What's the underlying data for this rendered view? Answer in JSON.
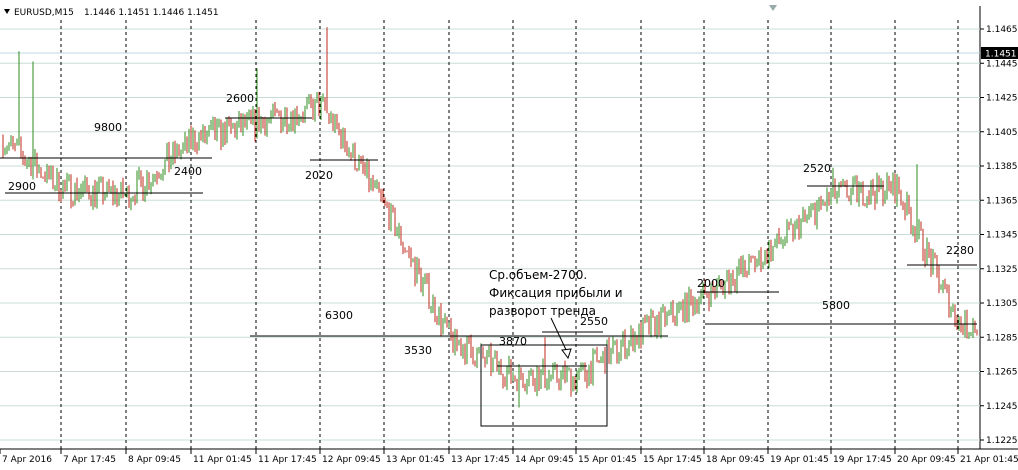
{
  "header": {
    "symbol": "EURUSD,M15",
    "ohlc": "1.1446 1.1451 1.1446 1.1451"
  },
  "price_axis": {
    "current_price": "1.1451",
    "levels": [
      "1.1465",
      "1.1445",
      "1.1425",
      "1.1405",
      "1.1385",
      "1.1365",
      "1.1345",
      "1.1325",
      "1.1305",
      "1.1285",
      "1.1265",
      "1.1245",
      "1.1225"
    ]
  },
  "time_axis": {
    "labels": [
      "7 Apr 2016",
      "7 Apr 17:45",
      "8 Apr 09:45",
      "11 Apr 01:45",
      "11 Apr 17:45",
      "12 Apr 09:45",
      "13 Apr 01:45",
      "13 Apr 17:45",
      "14 Apr 09:45",
      "15 Apr 01:45",
      "15 Apr 17:45",
      "18 Apr 09:45",
      "19 Apr 01:45",
      "19 Apr 17:45",
      "20 Apr 09:45",
      "21 Apr 01:45"
    ]
  },
  "annotations": {
    "v9800": "9800",
    "v2900": "2900",
    "v2400": "2400",
    "v2600": "2600",
    "v2020": "2020",
    "v6300": "6300",
    "v3530": "3530",
    "v3870": "3870",
    "v2550": "2550",
    "v2000": "2000",
    "v5800": "5800",
    "v2520": "2520",
    "v2280": "2280",
    "note_line1": "Ср.объем-2700.",
    "note_line2": "Фиксация прибыли и",
    "note_line3": "разворот тренда"
  },
  "colors": {
    "bull": "#2e8b1e",
    "bear": "#c0281c",
    "grid": "#c8ddd6",
    "current_line": "#b8d8e0"
  },
  "chart_data": {
    "type": "candlestick",
    "ylim": [
      1.122,
      1.148
    ],
    "key_closes": [
      {
        "x": "7 Apr 2016",
        "y": 1.14
      },
      {
        "x": "7 Apr 17:45",
        "y": 1.1372
      },
      {
        "x": "8 Apr 09:45",
        "y": 1.1368
      },
      {
        "x": "11 Apr 01:45",
        "y": 1.14
      },
      {
        "x": "11 Apr 17:45",
        "y": 1.141
      },
      {
        "x": "12 Apr 09:45",
        "y": 1.142
      },
      {
        "x": "13 Apr 01:45",
        "y": 1.136
      },
      {
        "x": "13 Apr 17:45",
        "y": 1.1283
      },
      {
        "x": "14 Apr 09:45",
        "y": 1.1262
      },
      {
        "x": "15 Apr 01:45",
        "y": 1.1262
      },
      {
        "x": "15 Apr 17:45",
        "y": 1.1288
      },
      {
        "x": "18 Apr 09:45",
        "y": 1.131
      },
      {
        "x": "19 Apr 01:45",
        "y": 1.1335
      },
      {
        "x": "19 Apr 17:45",
        "y": 1.1368
      },
      {
        "x": "20 Apr 09:45",
        "y": 1.1372
      },
      {
        "x": "21 Apr 01:45",
        "y": 1.1292
      }
    ]
  }
}
